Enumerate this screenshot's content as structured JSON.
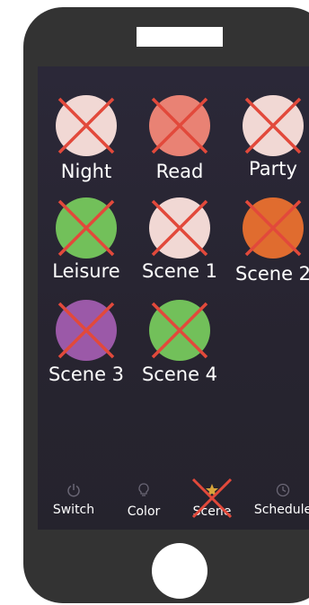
{
  "colors": {
    "phone_body": "#333333",
    "screen": "#29263a",
    "cross": "#e2493b",
    "tab_icon": "#6b6776",
    "tab_star": "#d8a53a"
  },
  "scenes": [
    {
      "label": "Night",
      "color": "#f1d8d4"
    },
    {
      "label": "Read",
      "color": "#e98274"
    },
    {
      "label": "Party",
      "color": "#f1d8d4"
    },
    {
      "label": "Leisure",
      "color": "#72c05a"
    },
    {
      "label": "Scene 1",
      "color": "#f1d8d4"
    },
    {
      "label": "Scene 2",
      "color": "#e06c2f"
    },
    {
      "label": "Scene 3",
      "color": "#9b59a8"
    },
    {
      "label": "Scene 4",
      "color": "#72c05a"
    }
  ],
  "tabs": [
    {
      "label": "Switch",
      "icon": "power-icon"
    },
    {
      "label": "Color",
      "icon": "bulb-icon"
    },
    {
      "label": "Scene",
      "icon": "star-icon"
    },
    {
      "label": "Schedule",
      "icon": "clock-icon"
    }
  ]
}
